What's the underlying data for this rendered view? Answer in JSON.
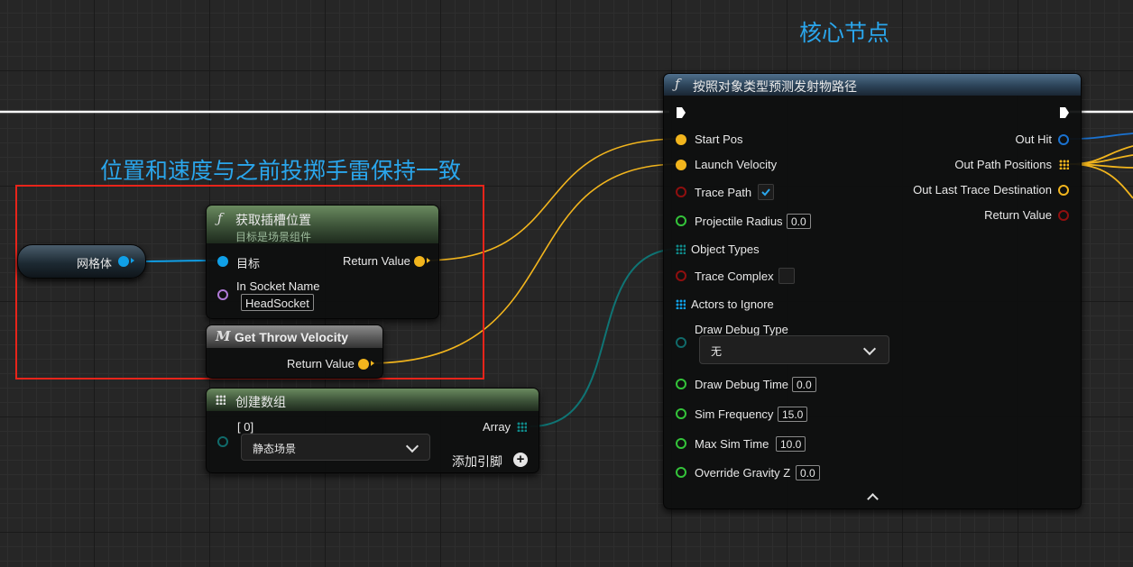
{
  "comments": {
    "core_title": "核心节点",
    "consistency_note": "位置和速度与之前投掷手雷保持一致"
  },
  "mesh_variable": {
    "label": "网格体"
  },
  "socket_node": {
    "title": "获取插槽位置",
    "subtitle": "目标是场景组件",
    "target_label": "目标",
    "socket_name_label": "In Socket Name",
    "socket_name_value": "HeadSocket",
    "return_label": "Return Value"
  },
  "velocity_node": {
    "icon": "M",
    "title": "Get Throw Velocity",
    "return_label": "Return Value"
  },
  "array_node": {
    "title": "创建数组",
    "index_label": "[ 0]",
    "selected_value": "静态场景",
    "array_label": "Array",
    "add_pin_label": "添加引脚"
  },
  "predict_node": {
    "title": "按照对象类型预测发射物路径",
    "inputs": {
      "start_pos": "Start Pos",
      "launch_velocity": "Launch Velocity",
      "trace_path": "Trace Path",
      "projectile_radius": "Projectile Radius",
      "projectile_radius_value": "0.0",
      "object_types": "Object Types",
      "trace_complex": "Trace Complex",
      "actors_to_ignore": "Actors to Ignore",
      "draw_debug_type": "Draw Debug Type",
      "draw_debug_type_value": "无",
      "draw_debug_time": "Draw Debug Time",
      "draw_debug_time_value": "0.0",
      "sim_frequency": "Sim Frequency",
      "sim_frequency_value": "15.0",
      "max_sim_time": "Max Sim Time",
      "max_sim_time_value": "10.0",
      "override_gravity_z": "Override Gravity Z",
      "override_gravity_z_value": "0.0"
    },
    "trace_path_checked": true,
    "trace_complex_checked": false,
    "outputs": {
      "out_hit": "Out Hit",
      "out_path_positions": "Out Path Positions",
      "out_last_trace_destination": "Out Last Trace Destination",
      "return_value": "Return Value"
    }
  },
  "colors": {
    "comment_text": "#2aa6ec",
    "highlight_box": "#e8241a",
    "vector_pin": "#f2b51d",
    "object_pin": "#10a0e8",
    "float_pin": "#34c33a",
    "bool_pin": "#8f0f0f",
    "enum_pin": "#106a6a",
    "name_pin": "#b07ad8"
  }
}
